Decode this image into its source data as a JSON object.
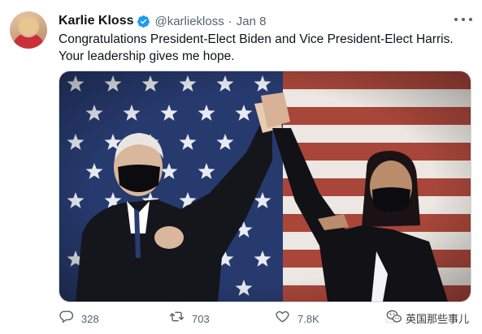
{
  "tweet": {
    "author": {
      "display_name": "Karlie Kloss",
      "handle": "@karliekloss",
      "verified_icon": "verified-badge-icon",
      "avatar": "profile-avatar"
    },
    "separator": "·",
    "date": "Jan 8",
    "text_lines": [
      "Congratulations President-Elect Biden and Vice President-Elect Harris.",
      "Your leadership gives me hope."
    ],
    "media": {
      "description_type": "photo",
      "colors": {
        "flag_red": "#a8463a",
        "flag_white": "#ece7e2",
        "flag_blue": "#273a6e"
      }
    },
    "actions": {
      "reply": {
        "icon": "reply-icon",
        "count": "328"
      },
      "retweet": {
        "icon": "retweet-icon",
        "count": "703"
      },
      "like": {
        "icon": "heart-icon",
        "count": "7.8K"
      },
      "share": {
        "icon": "share-icon"
      }
    },
    "more_icon": "more-options-icon"
  },
  "watermark": {
    "icon": "wechat-icon",
    "text": "英国那些事儿"
  },
  "colors": {
    "text_primary": "#0f1419",
    "text_secondary": "#536471",
    "verified_blue": "#1d9bf0"
  }
}
